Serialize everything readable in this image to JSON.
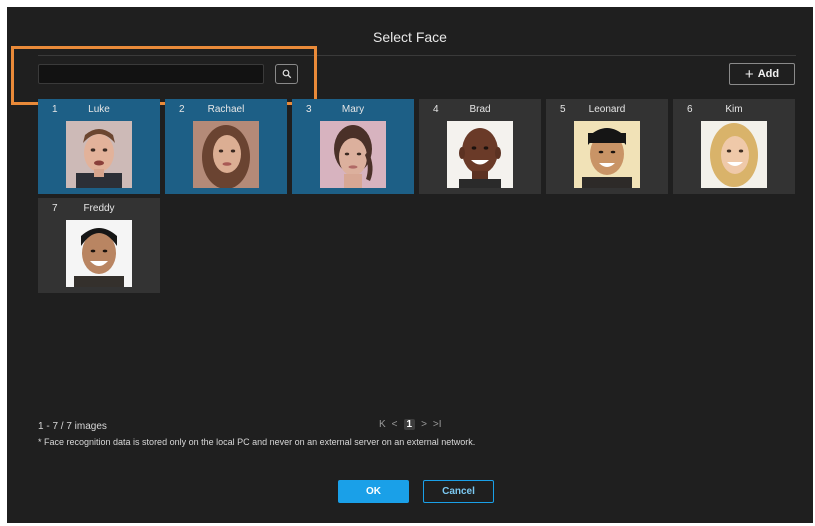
{
  "dialog": {
    "title": "Select Face"
  },
  "search": {
    "value": "",
    "placeholder": "",
    "icon": "search-icon"
  },
  "toolbar": {
    "add_icon": "+",
    "add_label": "Add"
  },
  "faces": [
    {
      "num": "1",
      "name": "Luke",
      "selected": true
    },
    {
      "num": "2",
      "name": "Rachael",
      "selected": true
    },
    {
      "num": "3",
      "name": "Mary",
      "selected": true
    },
    {
      "num": "4",
      "name": "Brad",
      "selected": false
    },
    {
      "num": "5",
      "name": "Leonard",
      "selected": false
    },
    {
      "num": "6",
      "name": "Kim",
      "selected": false
    },
    {
      "num": "7",
      "name": "Freddy",
      "selected": false
    }
  ],
  "footer": {
    "count": "1 - 7 / 7 images",
    "note": "* Face recognition data is stored only on the local PC and never on an external server on an external network."
  },
  "pager": {
    "first": "K",
    "prev": "<",
    "current": "1",
    "next": ">",
    "last": ">I"
  },
  "buttons": {
    "ok": "OK",
    "cancel": "Cancel"
  },
  "colors": {
    "background": "#1f1f1f",
    "selected_card": "#1d5f86",
    "card": "#333333",
    "accent": "#1aa0e8",
    "highlight": "#e98a39"
  }
}
